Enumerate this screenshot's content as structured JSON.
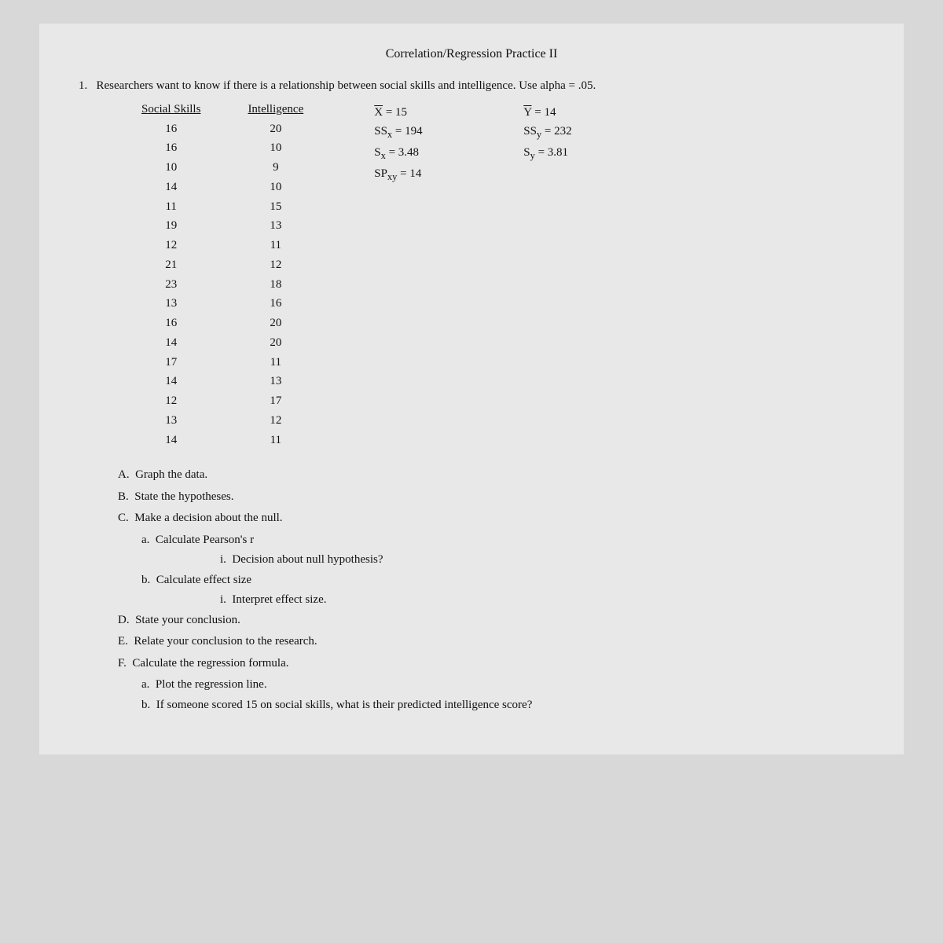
{
  "title": "Correlation/Regression Practice II",
  "question_number": "1.",
  "question_intro": "Researchers want to know if there is a relationship between social skills and intelligence. Use alpha = .05.",
  "columns": {
    "social_skills_header": "Social Skills",
    "intelligence_header": "Intelligence",
    "social_skills": [
      16,
      16,
      10,
      14,
      11,
      19,
      12,
      21,
      23,
      13,
      16,
      14,
      17,
      14,
      12,
      13,
      14
    ],
    "intelligence": [
      20,
      10,
      9,
      10,
      15,
      13,
      11,
      12,
      18,
      16,
      20,
      20,
      11,
      13,
      17,
      12,
      11
    ]
  },
  "stats": {
    "x_bar": "X̄ = 15",
    "y_bar": "Ȳ = 14",
    "ss_x": "SSx = 194",
    "ss_y": "SSy = 232",
    "s_x": "Sx = 3.48",
    "s_y": "Sy = 3.81",
    "sp_xy": "SPxy = 14"
  },
  "tasks": {
    "A": "Graph the data.",
    "B": "State the hypotheses.",
    "C": "Make a decision about the null.",
    "C_a": "Calculate Pearson's r",
    "C_a_i": "Decision about null hypothesis?",
    "C_b": "Calculate effect size",
    "C_b_i": "Interpret effect size.",
    "D": "State your conclusion.",
    "E": "Relate your conclusion to the research.",
    "F": "Calculate the regression formula.",
    "F_a": "Plot the regression line.",
    "F_b": "If someone scored 15 on social skills, what is their predicted intelligence score?"
  }
}
